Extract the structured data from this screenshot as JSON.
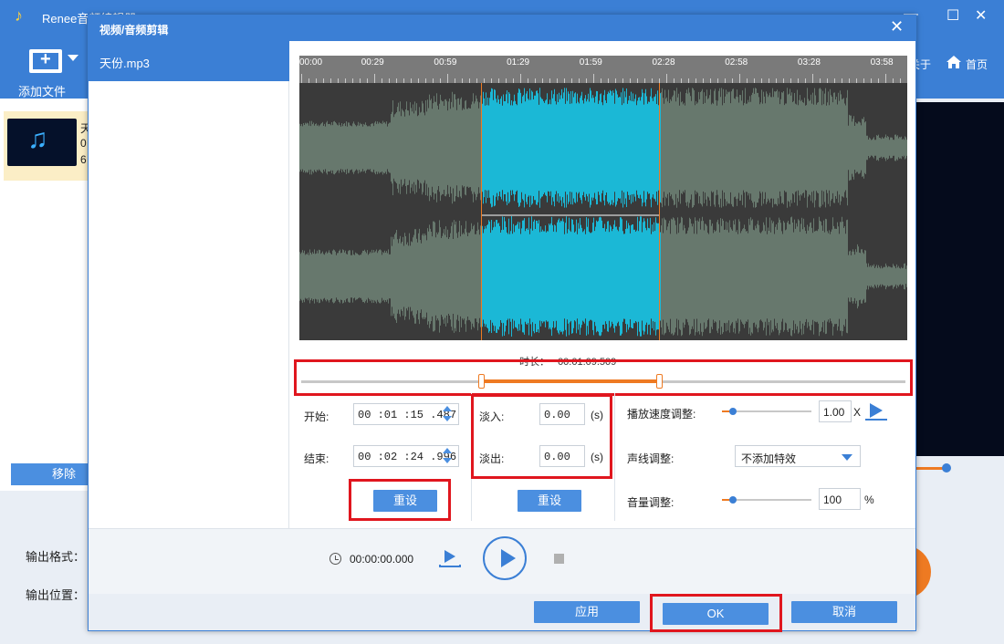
{
  "app": {
    "title": "Renee音频编辑器",
    "add_file_label": "添加文件",
    "about_label": "关于",
    "home_label": "首页",
    "file_card_lines": [
      "天",
      "0",
      "6"
    ],
    "remove_label": "移除",
    "output_format_label": "输出格式：",
    "output_location_label": "输出位置："
  },
  "dialog": {
    "title": "视频/音频剪辑",
    "close_icon": "close-icon",
    "file_list": [
      {
        "name": "天份.mp3",
        "selected": true
      }
    ],
    "ruler": {
      "labels": [
        "00:00",
        "00:29",
        "00:59",
        "01:29",
        "01:59",
        "02:28",
        "02:58",
        "03:28",
        "03:58"
      ]
    },
    "selection": {
      "start_s": 75.487,
      "end_s": 149.996,
      "total_s": 253
    },
    "duration_label": "时长：",
    "duration_value": "00:01:09.509",
    "trim": {
      "start_label": "开始:",
      "start_value": "00 :01 :15 .487",
      "end_label": "结束:",
      "end_value": "00 :02 :24 .996",
      "reset_label": "重设"
    },
    "fade": {
      "in_label": "淡入:",
      "in_value": "0.00",
      "out_label": "淡出:",
      "out_value": "0.00",
      "unit": "(s)",
      "reset_label": "重设"
    },
    "effects": {
      "speed_label": "播放速度调整:",
      "speed_value": "1.00",
      "speed_unit": "X",
      "speed_level": 0.1,
      "voice_label": "声线调整:",
      "voice_value": "不添加特效",
      "volume_label": "音量调整:",
      "volume_value": "100",
      "volume_unit": "%",
      "volume_level": 0.1
    },
    "playback": {
      "time": "00:00:00.000"
    },
    "buttons": {
      "apply": "应用",
      "ok": "OK",
      "cancel": "取消"
    }
  },
  "colors": {
    "accent": "#3b7fd5",
    "selection_wave": "#1bb8d6",
    "orange": "#ee7a22",
    "highlight_box": "#e0161e"
  }
}
